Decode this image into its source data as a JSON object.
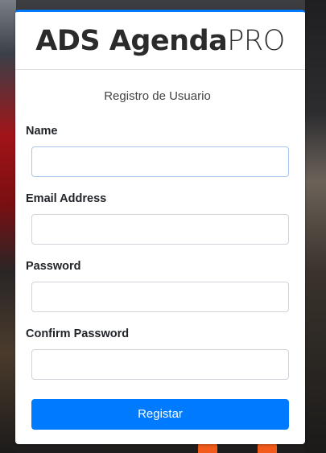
{
  "brand": {
    "bold": "ADS Agenda",
    "light": "PRO"
  },
  "form": {
    "message": "Registro de Usuario",
    "fields": [
      {
        "label": "Name",
        "value": ""
      },
      {
        "label": "Email Address",
        "value": ""
      },
      {
        "label": "Password",
        "value": ""
      },
      {
        "label": "Confirm Password",
        "value": ""
      }
    ],
    "submit_label": "Registar"
  },
  "colors": {
    "accent": "#007bff"
  }
}
